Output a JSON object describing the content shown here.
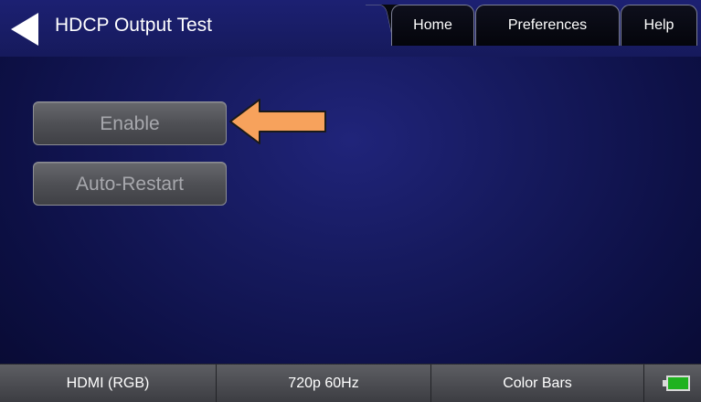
{
  "header": {
    "title": "HDCP Output Test",
    "back_icon": "back-arrow-icon",
    "tabs": [
      {
        "label": "Home"
      },
      {
        "label": "Preferences"
      },
      {
        "label": "Help"
      }
    ]
  },
  "main": {
    "buttons": [
      {
        "label": "Enable"
      },
      {
        "label": "Auto-Restart"
      }
    ],
    "annotation_icon": "arrow-left-icon",
    "annotation_color": "#f7a25c"
  },
  "statusbar": {
    "items": [
      {
        "label": "HDMI (RGB)"
      },
      {
        "label": "720p 60Hz"
      },
      {
        "label": "Color Bars"
      }
    ],
    "battery_icon": "battery-icon",
    "battery_color": "#1fb21f"
  }
}
